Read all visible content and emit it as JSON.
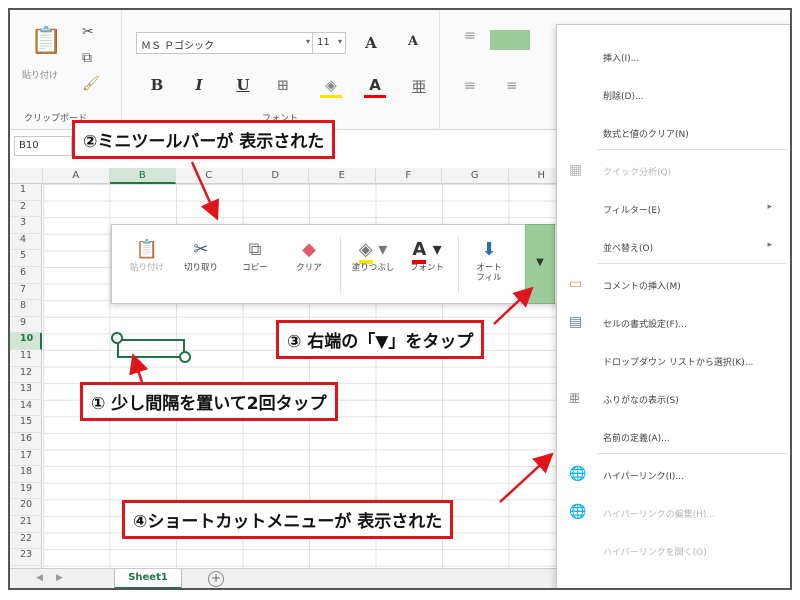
{
  "ribbon": {
    "clipboard": {
      "paste_label": "貼り付け",
      "group_label": "クリップボード"
    },
    "font": {
      "font_name": "ＭＳ Ｐゴシック",
      "font_size": "11",
      "bold": "B",
      "italic": "I",
      "underline": "U",
      "grow": "A",
      "shrink": "A",
      "font_color": "A",
      "group_label": "フォント"
    }
  },
  "name_box": "B10",
  "columns": [
    "A",
    "B",
    "C",
    "D",
    "E",
    "F",
    "G",
    "H"
  ],
  "rows": [
    "1",
    "2",
    "3",
    "4",
    "5",
    "6",
    "7",
    "8",
    "9",
    "10",
    "11",
    "12",
    "13",
    "14",
    "15",
    "16",
    "17",
    "18",
    "19",
    "20",
    "21",
    "22",
    "23"
  ],
  "sheet_tab": "Sheet1",
  "add_sheet": "+",
  "mini_toolbar": {
    "items": [
      {
        "label": "貼り付け",
        "icon": "paste-icon",
        "disabled": true
      },
      {
        "label": "切り取り",
        "icon": "cut-icon",
        "disabled": false
      },
      {
        "label": "コピー",
        "icon": "copy-icon",
        "disabled": false
      },
      {
        "label": "クリア",
        "icon": "eraser-icon",
        "disabled": false
      },
      {
        "label": "塗りつぶし",
        "icon": "fill-bucket-icon",
        "disabled": false
      },
      {
        "label": "フォント",
        "icon": "font-color-icon",
        "disabled": false
      },
      {
        "label": "オートフィル",
        "icon": "autofill-icon",
        "disabled": false
      }
    ],
    "more_arrow": "▼"
  },
  "context_menu": {
    "items": [
      {
        "label": "挿入(I)...",
        "disabled": false
      },
      {
        "label": "削除(D)...",
        "disabled": false
      },
      {
        "label": "数式と値のクリア(N)",
        "disabled": false
      },
      {
        "label": "クイック分析(Q)",
        "disabled": true
      },
      {
        "label": "フィルター(E)",
        "disabled": false,
        "submenu": true
      },
      {
        "label": "並べ替え(O)",
        "disabled": false,
        "submenu": true
      },
      {
        "label": "コメントの挿入(M)",
        "disabled": false
      },
      {
        "label": "セルの書式設定(F)...",
        "disabled": false
      },
      {
        "label": "ドロップダウン リストから選択(K)...",
        "disabled": false
      },
      {
        "label": "ふりがなの表示(S)",
        "disabled": false
      },
      {
        "label": "名前の定義(A)...",
        "disabled": false
      },
      {
        "label": "ハイパーリンク(I)...",
        "disabled": false
      },
      {
        "label": "ハイパーリンクの編集(H)...",
        "disabled": true
      },
      {
        "label": "ハイパーリンクを開く(O)",
        "disabled": true
      }
    ]
  },
  "callouts": {
    "step1": "① 少し間隔を置いて2回タップ",
    "step2": "②ミニツールバーが 表示された",
    "step3": "③ 右端の「▼」をタップ",
    "step4": "④ショートカットメニューが 表示された"
  },
  "colors": {
    "accent_green": "#217346",
    "callout_red": "#e0141b",
    "more_button_green": "#9ccc9c"
  }
}
